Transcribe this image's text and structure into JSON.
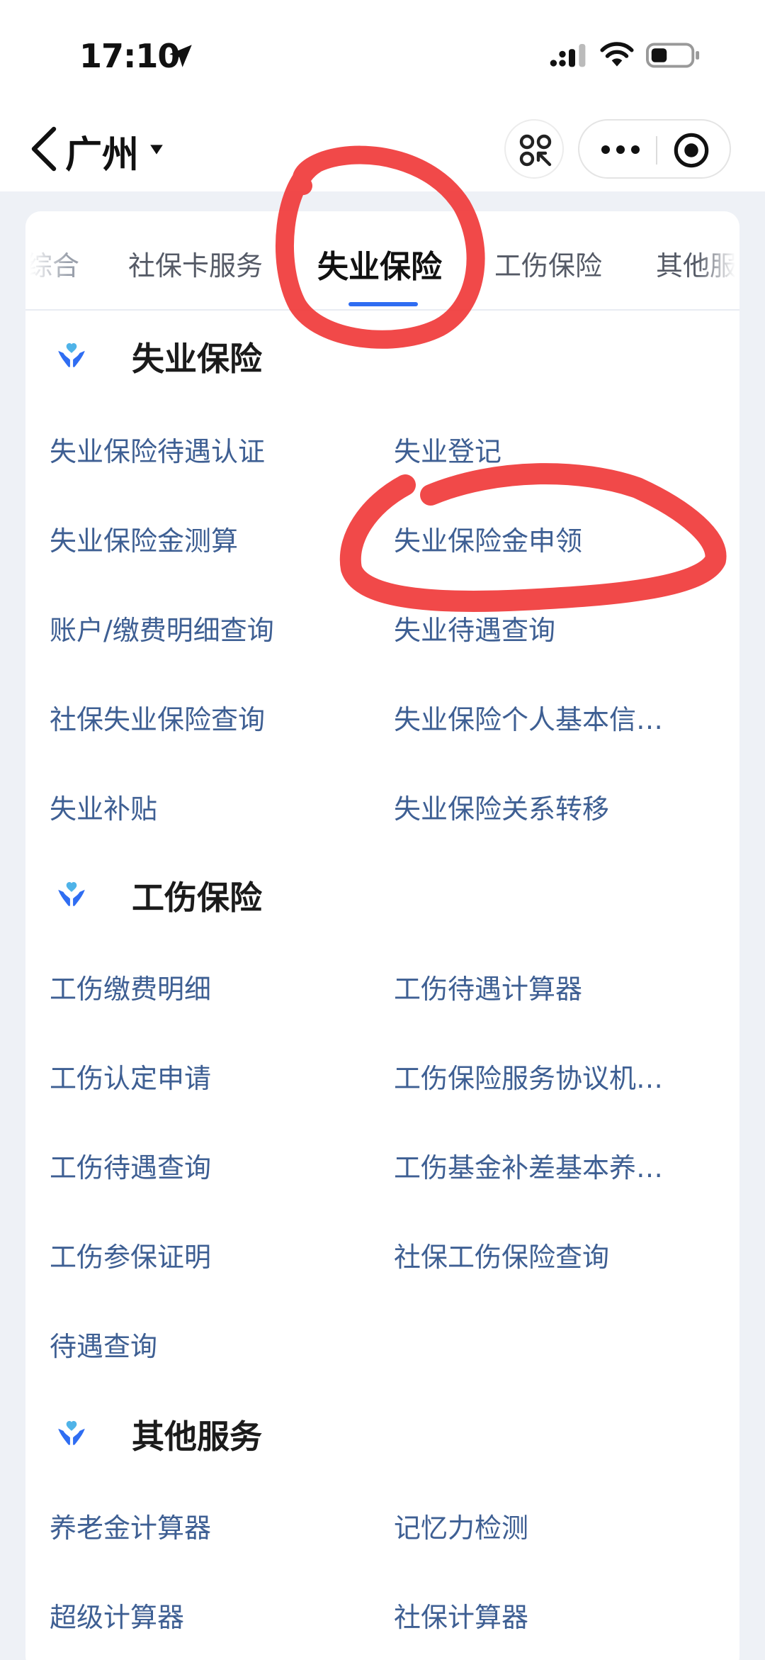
{
  "status_bar": {
    "time": "17:10"
  },
  "nav": {
    "city": "广州"
  },
  "tabs": [
    {
      "label": "综合"
    },
    {
      "label": "社保卡服务"
    },
    {
      "label": "失业保险"
    },
    {
      "label": "工伤保险"
    },
    {
      "label": "其他服"
    }
  ],
  "sections": [
    {
      "title": "失业保险",
      "items": [
        "失业保险待遇认证",
        "失业登记",
        "失业保险金测算",
        "失业保险金申领",
        "账户/缴费明细查询",
        "失业待遇查询",
        "社保失业保险查询",
        "失业保险个人基本信…",
        "失业补贴",
        "失业保险关系转移"
      ]
    },
    {
      "title": "工伤保险",
      "items": [
        "工伤缴费明细",
        "工伤待遇计算器",
        "工伤认定申请",
        "工伤保险服务协议机…",
        "工伤待遇查询",
        "工伤基金补差基本养…",
        "工伤参保证明",
        "社保工伤保险查询",
        "待遇查询"
      ]
    },
    {
      "title": "其他服务",
      "items": [
        "养老金计算器",
        "记忆力检测",
        "超级计算器",
        "社保计算器"
      ]
    }
  ],
  "colors": {
    "accent": "#2f6df2",
    "link_text": "#3e5f93",
    "annotation_red": "#f03a3a",
    "background": "#eef1f6"
  },
  "icons": {
    "section_icon": "hands-holding-heart-icon",
    "back": "chevron-left-icon",
    "scan": "scan-icon",
    "more": "more-dots-icon",
    "close": "target-close-icon"
  }
}
